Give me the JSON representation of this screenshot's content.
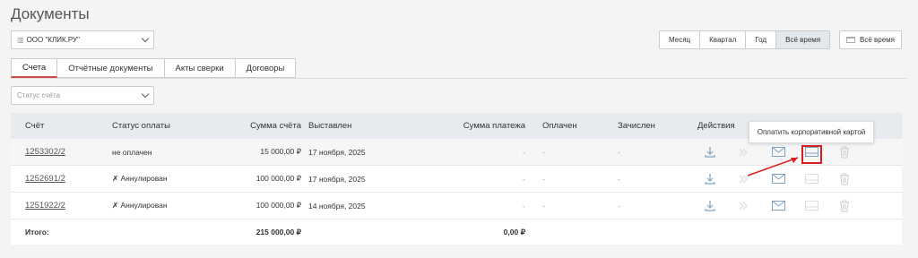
{
  "page": {
    "title": "Документы"
  },
  "org": {
    "value": "ООО \"КЛИК.РУ\""
  },
  "period": {
    "options": [
      "Месяц",
      "Квартал",
      "Год",
      "Всё время"
    ],
    "active": "Всё время",
    "range_label": "Всё время"
  },
  "tabs": [
    "Счета",
    "Отчётные документы",
    "Акты сверки",
    "Договоры"
  ],
  "status_filter": {
    "placeholder": "Статус счёта"
  },
  "table": {
    "headers": {
      "invoice": "Счёт",
      "payment_status": "Статус оплаты",
      "amount": "Сумма счёта",
      "issued": "Выставлен",
      "payment_sum": "Сумма платежа",
      "paid": "Оплачен",
      "credited": "Зачислен",
      "actions": "Действия"
    },
    "rows": [
      {
        "invoice": "1253302/2",
        "status": "не оплачен",
        "amount": "15 000,00 ₽",
        "issued": "17 ноября, 2025",
        "payment_sum": "-",
        "paid": "-",
        "credited": "-"
      },
      {
        "invoice": "1252691/2",
        "status": "✗ Аннулирован",
        "amount": "100 000,00 ₽",
        "issued": "17 ноября, 2025",
        "payment_sum": "-",
        "paid": "-",
        "credited": "-"
      },
      {
        "invoice": "1251922/2",
        "status": "✗ Аннулирован",
        "amount": "100 000,00 ₽",
        "issued": "14 ноября, 2025",
        "payment_sum": "-",
        "paid": "-",
        "credited": "-"
      }
    ],
    "total": {
      "label": "Итого:",
      "amount": "215 000,00 ₽",
      "payment_sum": "0,00 ₽"
    }
  },
  "tooltip": {
    "text": "Оплатить корпоративной картой"
  },
  "icons": [
    "download-icon",
    "forward-icon",
    "mail-icon",
    "card-icon",
    "trash-icon",
    "calendar-icon",
    "building-icon"
  ],
  "colors": {
    "accent": "#d04848",
    "highlight": "#d62020",
    "header_bg": "#e7ebef",
    "icon_blue": "#7fa3c2"
  }
}
